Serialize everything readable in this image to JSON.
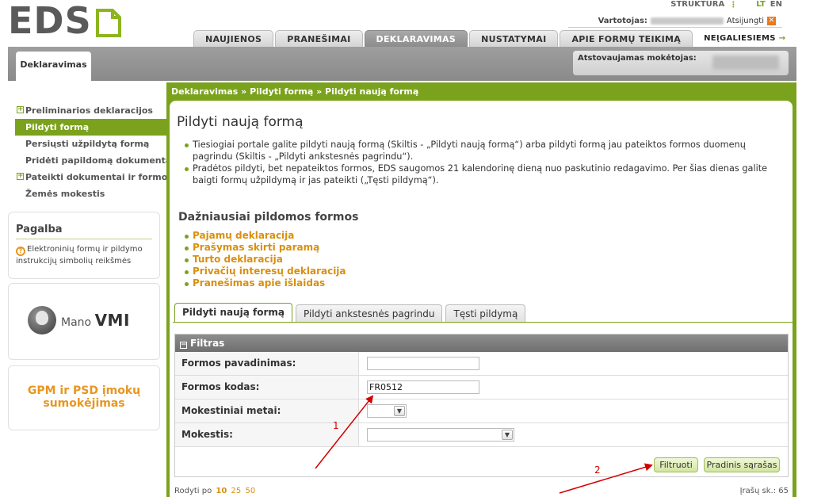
{
  "brand": {
    "logo_text": "EDS"
  },
  "top_links": {
    "structure": "STRUKTŪRA",
    "lang_lt": "LT",
    "lang_en": "EN"
  },
  "user": {
    "label": "Vartotojas:",
    "logout": "Atsijungti"
  },
  "main_tabs": [
    {
      "label": "NAUJIENOS"
    },
    {
      "label": "PRANEŠIMAI"
    },
    {
      "label": "DEKLARAVIMAS"
    },
    {
      "label": "NUSTATYMAI"
    },
    {
      "label": "APIE FORMŲ TEIKIMĄ"
    },
    {
      "label": "NEĮGALIESIEMS"
    }
  ],
  "section_tab": "Deklaravimas",
  "payer_label": "Atstovaujamas mokėtojas:",
  "sidebar": {
    "items": [
      {
        "label": "Preliminarios deklaracijos"
      },
      {
        "label": "Pildyti formą"
      },
      {
        "label": "Persiųsti užpildytą formą"
      },
      {
        "label": "Pridėti papildomą dokumentą"
      },
      {
        "label": "Pateikti dokumentai ir formos"
      },
      {
        "label": "Žemės mokestis"
      }
    ]
  },
  "help": {
    "title": "Pagalba",
    "text": "Elektroninių formų ir pildymo instrukcijų simbolių reikšmės"
  },
  "mano_vmi": {
    "prefix": "Mano",
    "suffix": "VMI"
  },
  "gpm": {
    "line1": "GPM ir PSD įmokų",
    "line2": "sumokėjimas"
  },
  "breadcrumb": "Deklaravimas » Pildyti formą » Pildyti naują formą",
  "page_title": "Pildyti naują formą",
  "intro": [
    "Tiesiogiai portale galite pildyti naują formą (Skiltis - „Pildyti naują formą“) arba pildyti formą jau pateiktos formos duomenų pagrindu (Skiltis - „Pildyti ankstesnės pagrindu“).",
    "Pradėtos pildyti, bet nepateiktos formos, EDS saugomos 21 kalendorinę dieną nuo paskutinio redagavimo. Per šias dienas galite baigti formų užpildymą ir jas pateikti („Tęsti pildymą“)."
  ],
  "frequent": {
    "title": "Dažniausiai pildomos formos",
    "items": [
      {
        "label": "Pajamų deklaracija"
      },
      {
        "label": "Prašymas skirti paramą"
      },
      {
        "label": "Turto deklaracija"
      },
      {
        "label": "Privačių interesų deklaracija"
      },
      {
        "label": "Pranešimas apie išlaidas"
      }
    ]
  },
  "subtabs": [
    {
      "label": "Pildyti naują formą"
    },
    {
      "label": "Pildyti ankstesnės pagrindu"
    },
    {
      "label": "Tęsti pildymą"
    }
  ],
  "filter": {
    "title": "Filtras",
    "form_name_label": "Formos pavadinimas:",
    "form_name_value": "",
    "form_code_label": "Formos kodas:",
    "form_code_value": "FR0512",
    "tax_year_label": "Mokestiniai metai:",
    "tax_year_value": "",
    "tax_label": "Mokestis:",
    "tax_value": "",
    "filter_button": "Filtruoti",
    "reset_button": "Pradinis sąrašas"
  },
  "paging": {
    "label": "Rodyti po",
    "sizes": [
      "10",
      "25",
      "50"
    ],
    "count_label": "Įrašų sk.:",
    "count": "65"
  },
  "annotations": {
    "marker1": "1",
    "marker2": "2"
  },
  "colors": {
    "accent_green": "#7aa21d",
    "link_orange": "#d98f0e",
    "annotation_red": "#d40000"
  }
}
